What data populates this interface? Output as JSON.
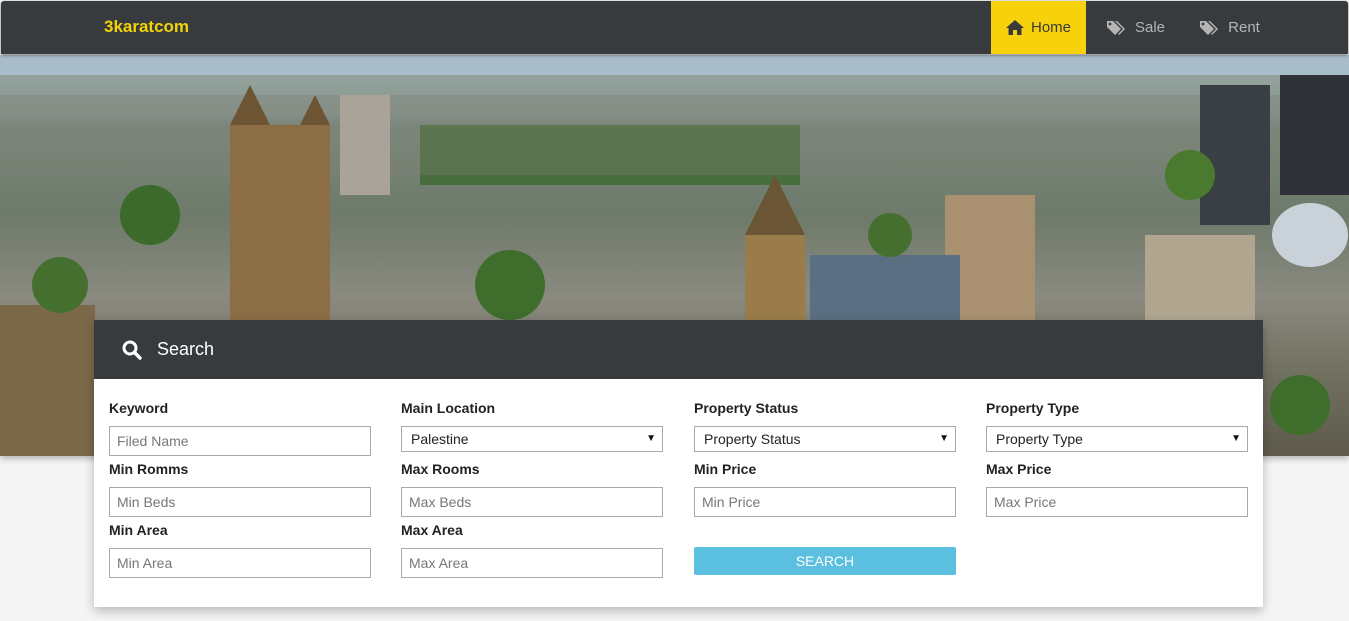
{
  "navbar": {
    "brand": "3karatcom",
    "items": [
      {
        "label": "Home",
        "icon": "home-icon",
        "active": true
      },
      {
        "label": "Sale",
        "icon": "tags-icon"
      },
      {
        "label": "Rent",
        "icon": "tags-icon"
      }
    ]
  },
  "search": {
    "title": "Search",
    "keyword": {
      "label": "Keyword",
      "placeholder": "Filed Name"
    },
    "main_location": {
      "label": "Main Location",
      "value": "Palestine"
    },
    "property_status": {
      "label": "Property Status",
      "value": "Property Status"
    },
    "property_type": {
      "label": "Property Type",
      "value": "Property Type"
    },
    "min_rooms": {
      "label": "Min Romms",
      "placeholder": "Min Beds"
    },
    "max_rooms": {
      "label": "Max Rooms",
      "placeholder": "Max Beds"
    },
    "min_price": {
      "label": "Min Price",
      "placeholder": "Min Price"
    },
    "max_price": {
      "label": "Max Price",
      "placeholder": "Max Price"
    },
    "min_area": {
      "label": "Min Area",
      "placeholder": "Min Area"
    },
    "max_area": {
      "label": "Max Area",
      "placeholder": "Max Area"
    },
    "button_label": "SEARCH"
  },
  "colors": {
    "navbar_bg": "#373b3d",
    "brand": "#f3d20a",
    "active_nav": "#f7d10c",
    "search_button": "#5bbfe0"
  }
}
